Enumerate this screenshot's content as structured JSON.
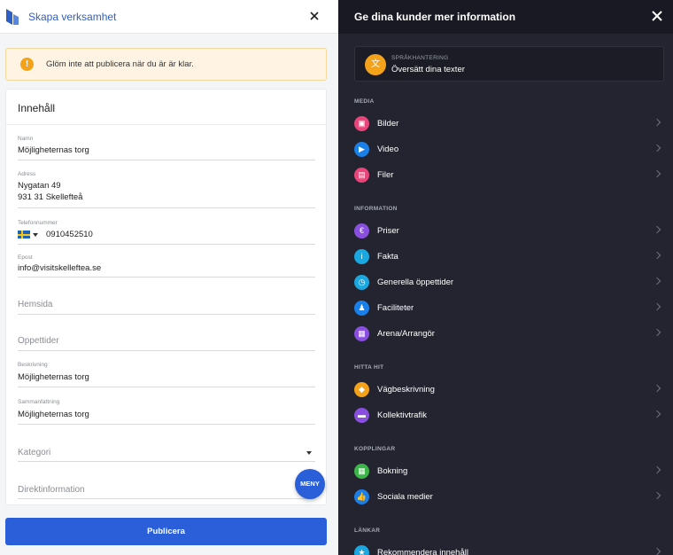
{
  "left": {
    "header_title": "Skapa verksamhet",
    "warning": "Glöm inte att publicera när du är är klar.",
    "card_title": "Innehåll",
    "fields": {
      "name": {
        "label": "Namn",
        "value": "Möjligheternas torg"
      },
      "address": {
        "label": "Adress",
        "line1": "Nygatan 49",
        "line2": "931 31 Skellefteå"
      },
      "phone": {
        "label": "Telefonnummer",
        "value": "0910452510"
      },
      "email": {
        "label": "Epost",
        "value": "info@visitskelleftea.se"
      },
      "website": {
        "placeholder": "Hemsida"
      },
      "opening": {
        "placeholder": "Oppettider"
      },
      "description": {
        "label": "Beskrivning",
        "value": "Möjligheternas torg"
      },
      "summary": {
        "label": "Sammanfattning",
        "value": "Möjligheternas torg"
      },
      "category": {
        "placeholder": "Kategori"
      },
      "direct": {
        "placeholder": "Direktinformation"
      }
    },
    "menu_button": "MENY",
    "publish_button": "Publicera"
  },
  "right": {
    "header_title": "Ge dina kunder mer information",
    "language": {
      "small": "SPRÅKHANTERING",
      "text": "Översätt dina texter",
      "icon": "translate-icon",
      "color": "#f4a21a"
    },
    "sections": [
      {
        "title": "MEDIA",
        "items": [
          {
            "label": "Bilder",
            "icon": "image-icon",
            "color": "#e8457a"
          },
          {
            "label": "Video",
            "icon": "video-icon",
            "color": "#1a7fe8"
          },
          {
            "label": "Filer",
            "icon": "file-icon",
            "color": "#e8457a"
          }
        ]
      },
      {
        "title": "INFORMATION",
        "items": [
          {
            "label": "Priser",
            "icon": "euro-icon",
            "color": "#8a4fe0"
          },
          {
            "label": "Fakta",
            "icon": "info-icon",
            "color": "#1ba7e0"
          },
          {
            "label": "Generella öppettider",
            "icon": "clock-icon",
            "color": "#1ba7e0"
          },
          {
            "label": "Faciliteter",
            "icon": "people-icon",
            "color": "#1a7fe8"
          },
          {
            "label": "Arena/Arrangör",
            "icon": "calendar-icon",
            "color": "#8a4fe0"
          }
        ]
      },
      {
        "title": "HITTA HIT",
        "items": [
          {
            "label": "Vägbeskrivning",
            "icon": "directions-icon",
            "color": "#f4a21a"
          },
          {
            "label": "Kollektivtrafik",
            "icon": "bus-icon",
            "color": "#8a4fe0"
          }
        ]
      },
      {
        "title": "KOPPLINGAR",
        "items": [
          {
            "label": "Bokning",
            "icon": "booking-icon",
            "color": "#3cb44a"
          },
          {
            "label": "Sociala medier",
            "icon": "thumbs-up-icon",
            "color": "#1a7fe8"
          }
        ]
      },
      {
        "title": "LÄNKAR",
        "items": [
          {
            "label": "Rekommendera innehåll",
            "icon": "star-icon",
            "color": "#1ba7e0"
          }
        ]
      }
    ]
  }
}
